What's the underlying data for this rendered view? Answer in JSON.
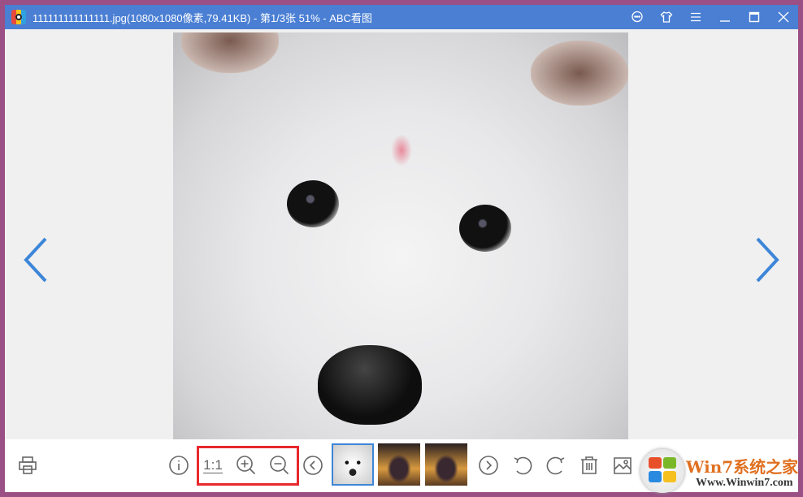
{
  "titlebar": {
    "title": "111111111111111.jpg(1080x1080像素,79.41KB) - 第1/3张 51% - ABC看图",
    "buttons": [
      "feedback-icon",
      "skin-icon",
      "menu-icon",
      "minimize-icon",
      "maximize-icon",
      "close-icon"
    ]
  },
  "toolbar": {
    "ratio_label": "1:1",
    "icons": [
      "print-icon",
      "info-icon",
      "zoom-in-icon",
      "zoom-out-icon",
      "prev-icon",
      "next-icon",
      "rotate-left-icon",
      "rotate-right-icon",
      "delete-icon",
      "edit-image-icon"
    ]
  },
  "thumbnails": [
    {
      "selected": true
    },
    {
      "selected": false
    },
    {
      "selected": false
    }
  ],
  "watermark": {
    "brand": "Win7系统之家",
    "url": "Www.Winwin7.com"
  },
  "colors": {
    "titlebar": "#4a7fd4",
    "accent": "#3d86d8",
    "highlight": "#e8282e"
  }
}
